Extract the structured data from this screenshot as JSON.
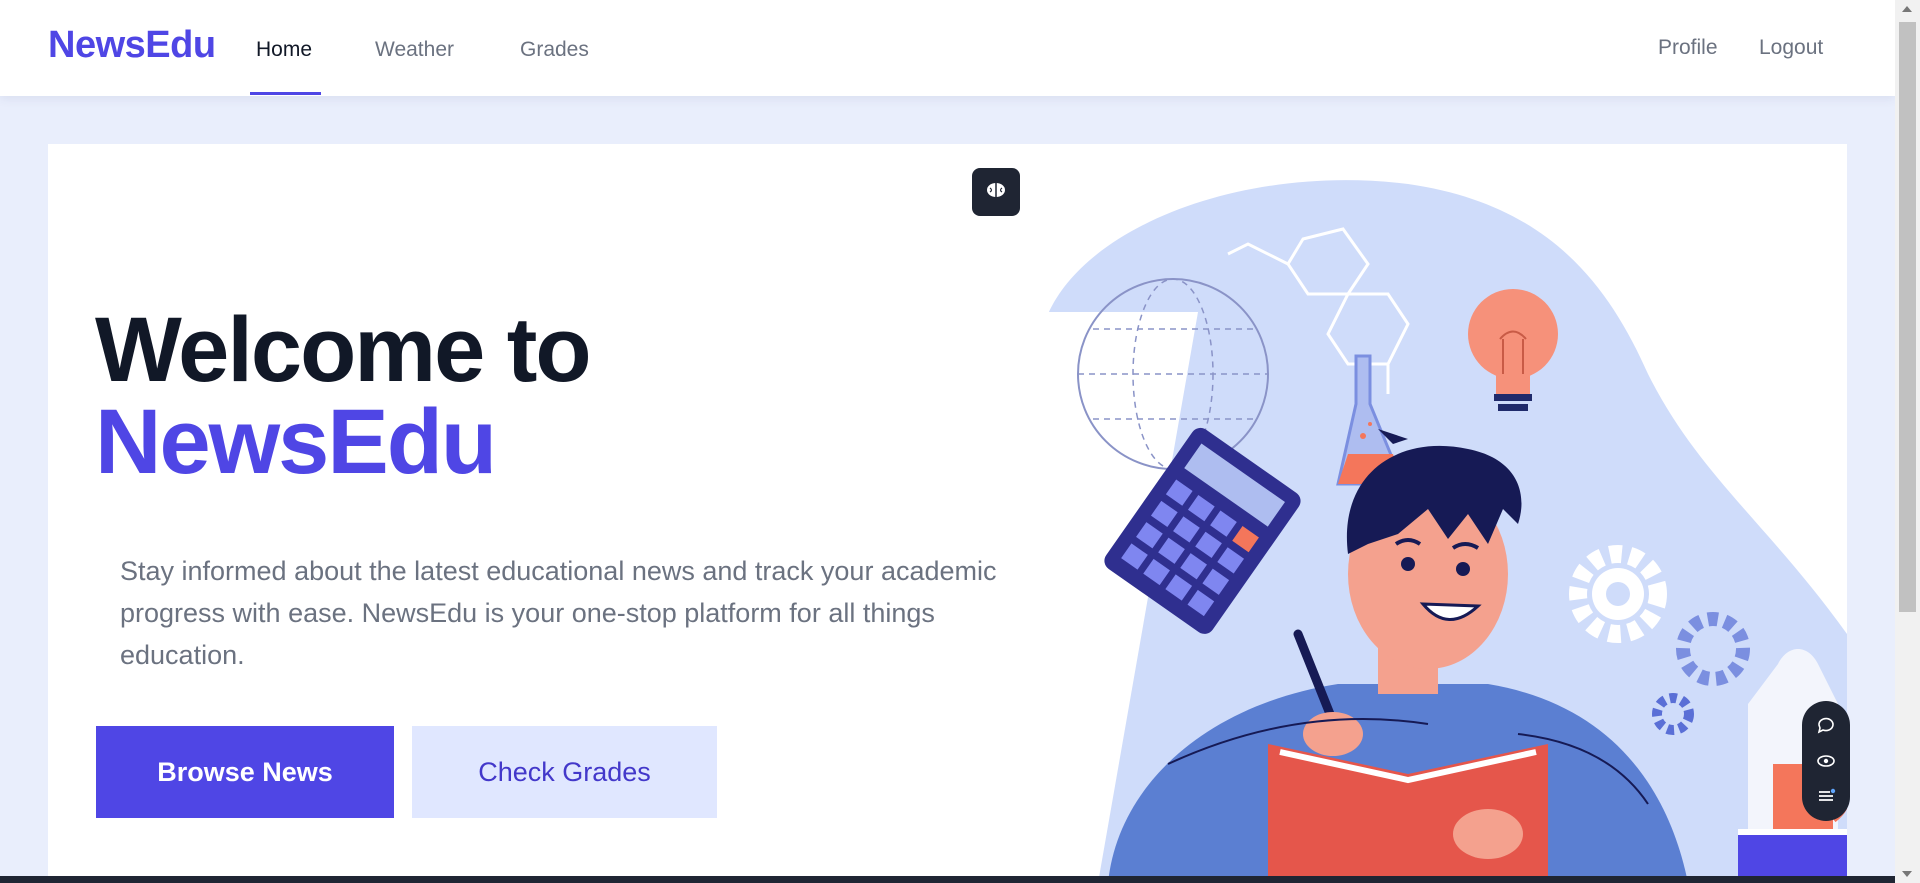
{
  "navbar": {
    "brand": "NewsEdu",
    "links": [
      {
        "label": "Home",
        "active": true
      },
      {
        "label": "Weather",
        "active": false
      },
      {
        "label": "Grades",
        "active": false
      }
    ],
    "right_links": [
      {
        "label": "Profile"
      },
      {
        "label": "Logout"
      }
    ]
  },
  "hero": {
    "title_line1": "Welcome to",
    "title_line2": "NewsEdu",
    "description": "Stay informed about the latest educational news and track your academic progress with ease. NewsEdu is your one-stop platform for all things education.",
    "primary_button": "Browse News",
    "secondary_button": "Check Grades"
  },
  "colors": {
    "accent": "#4f46e5",
    "secondary_bg": "#e0e7ff",
    "page_bg": "#e9eefc",
    "dark_ui": "#1f2533"
  },
  "icons": {
    "brain_chip": "brain-icon",
    "float_tools": [
      "chat-icon",
      "eye-icon",
      "list-icon"
    ]
  }
}
